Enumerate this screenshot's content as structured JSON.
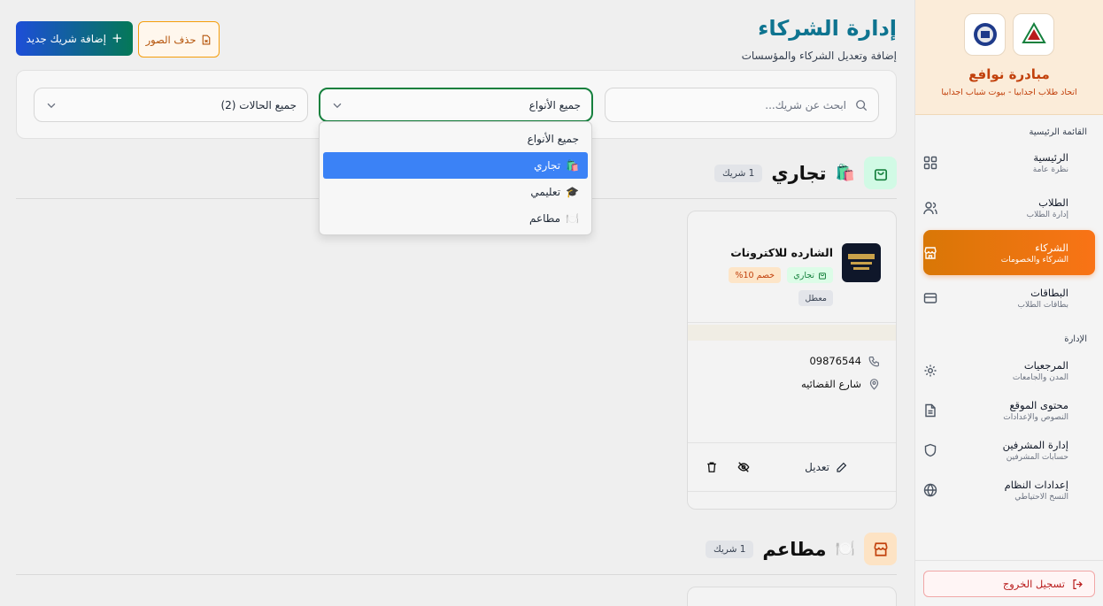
{
  "sidebar": {
    "brand_title": "مبادرة نوافع",
    "brand_sub": "اتحاد طلاب اجدابيا - بيوت شباب اجدابيا",
    "main_label": "القائمة الرئيسية",
    "admin_label": "الإدارة",
    "main_items": [
      {
        "title": "الرئيسية",
        "sub": "نظرة عامة",
        "icon": "grid-icon"
      },
      {
        "title": "الطلاب",
        "sub": "إدارة الطلاب",
        "icon": "users-icon"
      },
      {
        "title": "الشركاء",
        "sub": "الشركاء والخصومات",
        "icon": "store-icon",
        "active": true
      },
      {
        "title": "البطاقات",
        "sub": "بطاقات الطلاب",
        "icon": "card-icon"
      }
    ],
    "admin_items": [
      {
        "title": "المرجعيات",
        "sub": "المدن والجامعات",
        "icon": "gear-icon"
      },
      {
        "title": "محتوى الموقع",
        "sub": "النصوص والإعدادات",
        "icon": "document-icon"
      },
      {
        "title": "إدارة المشرفين",
        "sub": "حسابات المشرفين",
        "icon": "shield-icon"
      },
      {
        "title": "إعدادات النظام",
        "sub": "النسخ الاحتياطي",
        "icon": "globe-icon"
      }
    ],
    "logout": "تسجيل الخروج"
  },
  "header": {
    "title": "إدارة الشركاء",
    "subtitle": "إضافة وتعديل الشركاء والمؤسسات",
    "add_button": "إضافة شريك جديد",
    "delete_images_button": "حذف الصور"
  },
  "filters": {
    "search_placeholder": "ابحث عن شريك...",
    "type_value": "جميع الأنواع",
    "status_value": "جميع الحالات (2)",
    "type_options": [
      {
        "label": "جميع  الأنواع",
        "emoji": ""
      },
      {
        "label": "تجاري",
        "emoji": "🛍️",
        "selected": true
      },
      {
        "label": "تعليمي",
        "emoji": "🎓"
      },
      {
        "label": "مطاعم",
        "emoji": "🍽️"
      }
    ]
  },
  "groups": [
    {
      "title": "تجاري",
      "emoji": "🛍️",
      "count": "1 شريك",
      "color": "#15803d",
      "bg": "#d1fae5"
    },
    {
      "title": "مطاعم",
      "emoji": "🍽️",
      "count": "1 شريك",
      "color": "#c2410c",
      "bg": "#fde3c4"
    }
  ],
  "partner_card": {
    "name": "الشارده للاكترونات",
    "category": "تجاري",
    "discount": "خصم 10%",
    "status": "معطل",
    "phone": "09876544",
    "address": "شارع القضائيه",
    "edit_label": "تعديل"
  }
}
